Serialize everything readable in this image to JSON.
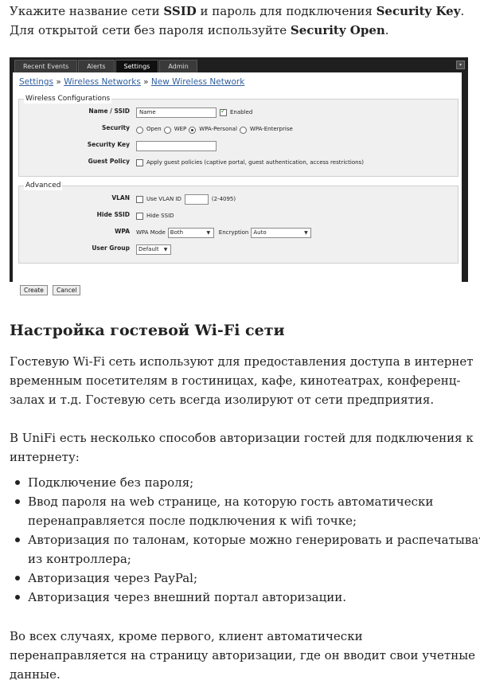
{
  "intro": {
    "t1": "Укажите название сети ",
    "b1": "SSID",
    "t2": " и пароль для подключения ",
    "b2": "Security Key",
    "t3": ". Для открытой сети без пароля используйте ",
    "b3": "Security Open",
    "t4": "."
  },
  "ui": {
    "tabs": [
      "Recent Events",
      "Alerts",
      "Settings",
      "Admin"
    ],
    "active_tab": "Settings",
    "breadcrumb": {
      "settings": "Settings",
      "sep": "»",
      "wireless": "Wireless Networks",
      "new": "New Wireless Network"
    },
    "wireless_config": {
      "legend": "Wireless Configurations",
      "ssid_label": "Name / SSID",
      "ssid_value": "Name",
      "enabled_label": "Enabled",
      "security_label": "Security",
      "security_options": [
        "Open",
        "WEP",
        "WPA-Personal",
        "WPA-Enterprise"
      ],
      "security_selected": "WPA-Personal",
      "key_label": "Security Key",
      "key_value": "",
      "guest_label": "Guest Policy",
      "guest_text": "Apply guest policies (captive portal, guest authentication, access restrictions)"
    },
    "advanced": {
      "legend": "Advanced",
      "vlan_label": "VLAN",
      "vlan_text": "Use VLAN ID",
      "vlan_range": "(2-4095)",
      "hide_label": "Hide SSID",
      "hide_text": "Hide SSID",
      "wpa_label": "WPA",
      "wpa_mode_label": "WPA Mode",
      "wpa_mode_value": "Both",
      "encryption_label": "Encryption",
      "encryption_value": "Auto",
      "group_label": "User Group",
      "group_value": "Default"
    },
    "buttons": {
      "create": "Create",
      "cancel": "Cancel"
    }
  },
  "heading": "Настройка гостевой Wi-Fi сети",
  "p2": "Гостевую Wi-Fi сеть используют для предоставления доступа в интернет временным посетителям в гостиницах, кафе, кинотеатрах, конференц-залах и т.д. Гостевую сеть всегда изолируют от сети предприятия.",
  "p3": "В UniFi есть несколько способов авторизации гостей для подключения к интернету:",
  "list": [
    "Подключение без пароля;",
    "Ввод пароля на web странице, на которую гость автоматически перенаправляется после подключения к wifi точке;",
    "Авторизация по талонам, которые можно генерировать и распечатывать из контроллера;",
    "Авторизация через PayPal;",
    "Авторизация через внешний портал авторизации."
  ],
  "p4": "Во всех случаях, кроме первого, клиент автоматически перенаправляется на страницу авторизации, где он вводит свои учетные данные."
}
